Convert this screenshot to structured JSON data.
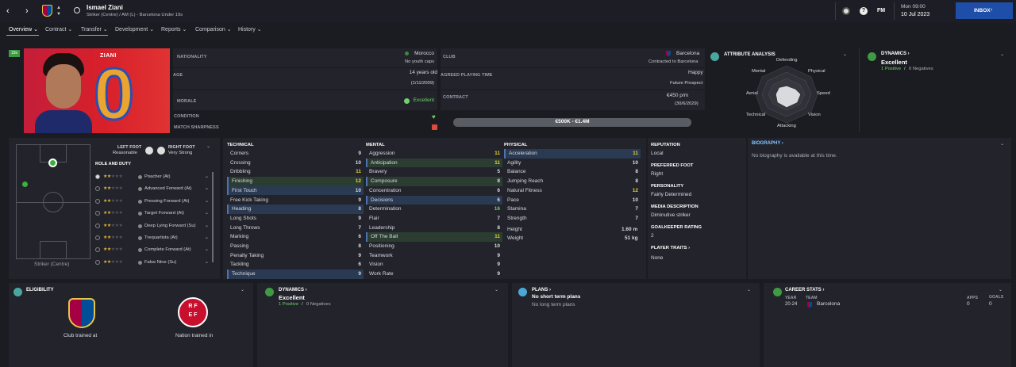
{
  "header": {
    "player_name": "Ismael Ziani",
    "subtitle": "Striker (Centre) / AM (L) - Barcelona Under 19s",
    "fm_label": "FM",
    "time": "Mon 09:00",
    "date": "10 Jul 2023",
    "inbox": "INBOX"
  },
  "tabs": [
    {
      "label": "Overview"
    },
    {
      "label": "Contract"
    },
    {
      "label": "Transfer"
    },
    {
      "label": "Development"
    },
    {
      "label": "Reports"
    },
    {
      "label": "Comparison"
    },
    {
      "label": "History"
    }
  ],
  "profile": {
    "badge": "19s",
    "shirt_name": "ZIANI",
    "shirt_number": "0",
    "nationality_label": "NATIONALITY",
    "nationality": "Morocco",
    "youth_caps": "No youth caps",
    "club_label": "CLUB",
    "club": "Barcelona",
    "contract_status": "Contracted to Barcelona",
    "age_label": "AGE",
    "age": "14 years old",
    "dob": "(1/11/2009)",
    "playing_time_label": "AGREED PLAYING TIME",
    "playing_time_mood": "Happy",
    "playing_time": "Future Prospect",
    "morale_label": "MORALE",
    "morale": "Excellent",
    "contract_label": "CONTRACT",
    "wage": "€450 p/m",
    "contract_end": "(30/6/2029)",
    "condition_label": "CONDITION",
    "sharpness_label": "MATCH SHARPNESS",
    "value": "€500K - €1.4M"
  },
  "attribute_analysis": {
    "title": "ATTRIBUTE ANALYSIS",
    "axes": [
      "Defending",
      "Physical",
      "Speed",
      "Vision",
      "Attacking",
      "Technical",
      "Aerial",
      "Mental"
    ]
  },
  "dynamics_top": {
    "title": "DYNAMICS",
    "rating": "Excellent",
    "positives": "1 Positive",
    "separator": "/",
    "negatives": "0 Negatives"
  },
  "pitch": {
    "position_label": "Striker (Centre)",
    "left_foot_label": "LEFT FOOT",
    "left_foot": "Reasonable",
    "right_foot_label": "RIGHT FOOT",
    "right_foot": "Very Strong",
    "role_duty_label": "ROLE AND DUTY"
  },
  "roles": [
    {
      "name": "Poacher (At)",
      "stars": 1.5
    },
    {
      "name": "Advanced Forward (At)",
      "stars": 1.5
    },
    {
      "name": "Pressing Forward (At)",
      "stars": 1.5
    },
    {
      "name": "Target Forward (At)",
      "stars": 1.5
    },
    {
      "name": "Deep Lying Forward (Su)",
      "stars": 1.5
    },
    {
      "name": "Trequartista (At)",
      "stars": 1.5
    },
    {
      "name": "Complete Forward (At)",
      "stars": 1.5
    },
    {
      "name": "False Nine (Su)",
      "stars": 1.5
    }
  ],
  "technical": {
    "title": "TECHNICAL",
    "items": [
      {
        "name": "Corners",
        "value": "9",
        "hl": ""
      },
      {
        "name": "Crossing",
        "value": "10",
        "hl": ""
      },
      {
        "name": "Dribbling",
        "value": "11",
        "hl": ""
      },
      {
        "name": "Finishing",
        "value": "12",
        "hl": "green"
      },
      {
        "name": "First Touch",
        "value": "10",
        "hl": "blue"
      },
      {
        "name": "Free Kick Taking",
        "value": "9",
        "hl": ""
      },
      {
        "name": "Heading",
        "value": "8",
        "hl": "blue"
      },
      {
        "name": "Long Shots",
        "value": "9",
        "hl": ""
      },
      {
        "name": "Long Throws",
        "value": "7",
        "hl": ""
      },
      {
        "name": "Marking",
        "value": "6",
        "hl": ""
      },
      {
        "name": "Passing",
        "value": "8",
        "hl": ""
      },
      {
        "name": "Penalty Taking",
        "value": "9",
        "hl": ""
      },
      {
        "name": "Tackling",
        "value": "6",
        "hl": ""
      },
      {
        "name": "Technique",
        "value": "9",
        "hl": "blue"
      }
    ]
  },
  "mental": {
    "title": "MENTAL",
    "items": [
      {
        "name": "Aggression",
        "value": "11",
        "hl": ""
      },
      {
        "name": "Anticipation",
        "value": "11",
        "hl": "green"
      },
      {
        "name": "Bravery",
        "value": "5",
        "hl": ""
      },
      {
        "name": "Composure",
        "value": "8",
        "hl": "green"
      },
      {
        "name": "Concentration",
        "value": "6",
        "hl": ""
      },
      {
        "name": "Decisions",
        "value": "6",
        "hl": "blue"
      },
      {
        "name": "Determination",
        "value": "16",
        "hl": ""
      },
      {
        "name": "Flair",
        "value": "7",
        "hl": ""
      },
      {
        "name": "Leadership",
        "value": "8",
        "hl": ""
      },
      {
        "name": "Off The Ball",
        "value": "11",
        "hl": "green"
      },
      {
        "name": "Positioning",
        "value": "10",
        "hl": ""
      },
      {
        "name": "Teamwork",
        "value": "9",
        "hl": ""
      },
      {
        "name": "Vision",
        "value": "9",
        "hl": ""
      },
      {
        "name": "Work Rate",
        "value": "9",
        "hl": ""
      }
    ]
  },
  "physical": {
    "title": "PHYSICAL",
    "items": [
      {
        "name": "Acceleration",
        "value": "11",
        "hl": "blue"
      },
      {
        "name": "Agility",
        "value": "10",
        "hl": ""
      },
      {
        "name": "Balance",
        "value": "8",
        "hl": ""
      },
      {
        "name": "Jumping Reach",
        "value": "8",
        "hl": ""
      },
      {
        "name": "Natural Fitness",
        "value": "12",
        "hl": ""
      },
      {
        "name": "Pace",
        "value": "10",
        "hl": ""
      },
      {
        "name": "Stamina",
        "value": "7",
        "hl": ""
      },
      {
        "name": "Strength",
        "value": "7",
        "hl": ""
      }
    ],
    "height_label": "Height",
    "height": "1.60 m",
    "weight_label": "Weight",
    "weight": "51 kg"
  },
  "info": {
    "reputation_label": "REPUTATION",
    "reputation": "Local",
    "preferred_foot_label": "PREFERRED FOOT",
    "preferred_foot": "Right",
    "personality_label": "PERSONALITY",
    "personality": "Fairly Determined",
    "media_label": "MEDIA DESCRIPTION",
    "media": "Diminutive striker",
    "gk_label": "GOALKEEPER RATING",
    "gk": "2",
    "traits_label": "PLAYER TRAITS",
    "traits": "None"
  },
  "biography": {
    "title": "BIOGRAPHY",
    "text": "No biography is available at this time."
  },
  "eligibility": {
    "title": "ELIGIBILITY",
    "club_trained": "Club trained at",
    "nation_trained": "Nation trained in"
  },
  "dynamics_bottom": {
    "title": "DYNAMICS",
    "rating": "Excellent",
    "positives": "1 Positive",
    "separator": "/",
    "negatives": "0 Negatives"
  },
  "plans": {
    "title": "PLANS",
    "short": "No short term plans",
    "long": "No long term plans"
  },
  "career": {
    "title": "CAREER STATS",
    "year_label": "YEAR",
    "team_label": "TEAM",
    "apps_label": "APPS",
    "goals_label": "GOALS",
    "year": "20-24",
    "team": "Barcelona",
    "apps": "0",
    "goals": "0"
  },
  "colors": {
    "accent_green": "#6fd36a",
    "highlight_blue": "#2a3a52",
    "highlight_green": "#2b3d31",
    "inbox": "#1f4ea8"
  }
}
